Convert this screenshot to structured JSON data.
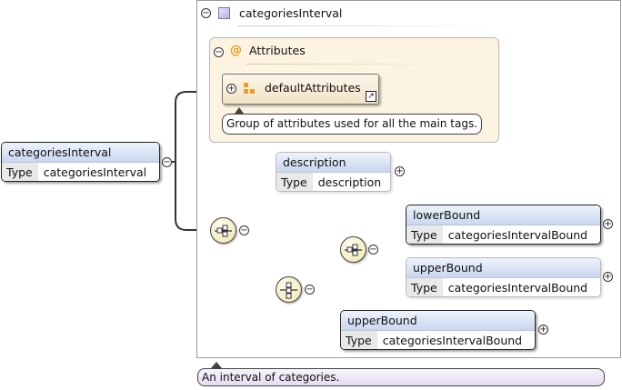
{
  "root": {
    "name": "categoriesInterval",
    "type_key": "Type",
    "type_value": "categoriesInterval"
  },
  "complex_type": {
    "title": "categoriesInterval",
    "documentation": "An interval of categories."
  },
  "attributes": {
    "title": "Attributes",
    "group": {
      "name": "defaultAttributes",
      "documentation": "Group of attributes used for all the main tags."
    }
  },
  "elements": {
    "description": {
      "name": "description",
      "type_key": "Type",
      "type_value": "description"
    },
    "lowerBound": {
      "name": "lowerBound",
      "type_key": "Type",
      "type_value": "categoriesIntervalBound"
    },
    "upperBound_optional": {
      "name": "upperBound",
      "type_key": "Type",
      "type_value": "categoriesIntervalBound"
    },
    "upperBound": {
      "name": "upperBound",
      "type_key": "Type",
      "type_value": "categoriesIntervalBound"
    }
  },
  "colors": {
    "header_gradient_top": "#eef3fb",
    "header_gradient_bottom": "#c9d7ef",
    "attribute_bg": "#fdf3e1",
    "compositor_fill": "#f0e4a8",
    "doc_bg": "#ede7f6"
  },
  "icons": [
    "collapse-icon",
    "expand-icon",
    "complex-type-icon",
    "attribute-at-icon",
    "attribute-group-icon",
    "shortcut-arrow-icon",
    "sequence-compositor-icon",
    "choice-compositor-icon"
  ]
}
